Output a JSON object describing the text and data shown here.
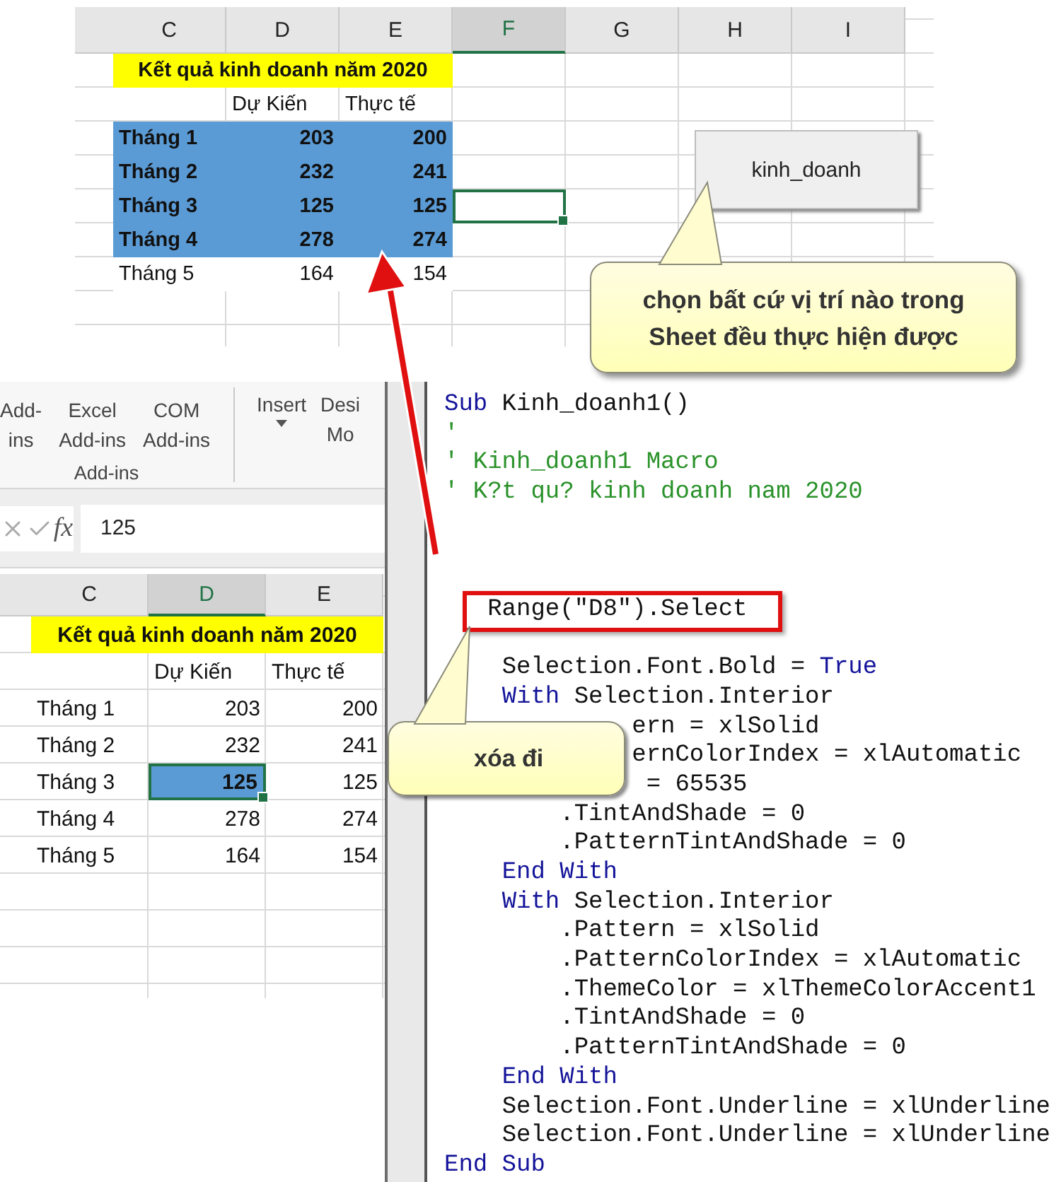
{
  "top_sheet": {
    "columns": [
      {
        "label": "C",
        "selected": false
      },
      {
        "label": "D",
        "selected": false
      },
      {
        "label": "E",
        "selected": false
      },
      {
        "label": "F",
        "selected": true
      },
      {
        "label": "G",
        "selected": false
      },
      {
        "label": "H",
        "selected": false
      },
      {
        "label": "I",
        "selected": false
      }
    ],
    "title": "Kết quả kinh doanh năm 2020",
    "headers": [
      "Dự Kiến",
      "Thực tế"
    ],
    "rows": [
      {
        "month": "Tháng 1",
        "planned": "203",
        "actual": "200",
        "highlighted": true,
        "f_selected": false
      },
      {
        "month": "Tháng 2",
        "planned": "232",
        "actual": "241",
        "highlighted": true,
        "f_selected": false
      },
      {
        "month": "Tháng 3",
        "planned": "125",
        "actual": "125",
        "highlighted": true,
        "f_selected": true
      },
      {
        "month": "Tháng 4",
        "planned": "278",
        "actual": "274",
        "highlighted": true,
        "f_selected": false
      },
      {
        "month": "Tháng 5",
        "planned": "164",
        "actual": "154",
        "highlighted": false,
        "f_selected": false
      }
    ]
  },
  "macro_button": {
    "label": "kinh_doanh"
  },
  "callouts": [
    {
      "kind": "top",
      "text": "chọn bất cứ vị trí nào trong Sheet đều thực hiện được"
    },
    {
      "kind": "code",
      "text": "xóa đi"
    }
  ],
  "ribbon": {
    "buttons": [
      {
        "label": "Add-\nins",
        "dropdown": false
      },
      {
        "label": "Excel\nAdd-ins",
        "dropdown": false
      },
      {
        "label": "COM\nAdd-ins",
        "dropdown": false
      },
      {
        "label": "Insert",
        "dropdown": true
      },
      {
        "label": "Desi\nMo",
        "dropdown": false
      }
    ],
    "group_label": "Add-ins"
  },
  "formula_bar": {
    "function_label": "fx",
    "value": "125"
  },
  "bottom_sheet": {
    "columns": [
      {
        "label": "C",
        "selected": false
      },
      {
        "label": "D",
        "selected": true
      },
      {
        "label": "E",
        "selected": false
      }
    ],
    "title": "Kết quả kinh doanh năm 2020",
    "headers": [
      "Dự Kiến",
      "Thực tế"
    ],
    "rows": [
      {
        "month": "Tháng 1",
        "planned": "203",
        "actual": "200",
        "selected": false
      },
      {
        "month": "Tháng 2",
        "planned": "232",
        "actual": "241",
        "selected": false
      },
      {
        "month": "Tháng 3",
        "planned": "125",
        "actual": "125",
        "selected": true
      },
      {
        "month": "Tháng 4",
        "planned": "278",
        "actual": "274",
        "selected": false
      },
      {
        "month": "Tháng 5",
        "planned": "164",
        "actual": "154",
        "selected": false
      }
    ]
  },
  "code_editor": {
    "lines": [
      {
        "kind": "code",
        "tokens": [
          {
            "kind": "keyword",
            "text": "Sub"
          },
          {
            "kind": "plain",
            "text": " Kinh_doanh1()"
          }
        ]
      },
      {
        "kind": "code",
        "tokens": [
          {
            "kind": "comment",
            "text": "'"
          }
        ]
      },
      {
        "kind": "code",
        "tokens": [
          {
            "kind": "comment",
            "text": "' Kinh_doanh1 Macro"
          }
        ]
      },
      {
        "kind": "code",
        "tokens": [
          {
            "kind": "comment",
            "text": "' K?t qu? kinh doanh nam 2020"
          }
        ]
      },
      {
        "kind": "blank"
      },
      {
        "kind": "blank"
      },
      {
        "kind": "blank"
      },
      {
        "kind": "code",
        "boxed": true,
        "tokens": [
          {
            "kind": "plain",
            "text": "   Range(\"D8\").Select"
          }
        ]
      },
      {
        "kind": "blank"
      },
      {
        "kind": "code",
        "tokens": [
          {
            "kind": "plain",
            "text": "    Selection.Font.Bold = "
          },
          {
            "kind": "keyword",
            "text": "True"
          }
        ]
      },
      {
        "kind": "code",
        "tokens": [
          {
            "kind": "keyword",
            "text": "    With"
          },
          {
            "kind": "plain",
            "text": " Selection.Interior"
          }
        ]
      },
      {
        "kind": "code",
        "tokens": [
          {
            "kind": "plain",
            "text": "             ern = xlSolid"
          }
        ]
      },
      {
        "kind": "code",
        "tokens": [
          {
            "kind": "plain",
            "text": "             ernColorIndex = xlAutomatic"
          }
        ]
      },
      {
        "kind": "code",
        "tokens": [
          {
            "kind": "plain",
            "text": "              = 65535"
          }
        ]
      },
      {
        "kind": "code",
        "tokens": [
          {
            "kind": "plain",
            "text": "        .TintAndShade = 0"
          }
        ]
      },
      {
        "kind": "code",
        "tokens": [
          {
            "kind": "plain",
            "text": "        .PatternTintAndShade = 0"
          }
        ]
      },
      {
        "kind": "code",
        "tokens": [
          {
            "kind": "keyword",
            "text": "    End With"
          }
        ]
      },
      {
        "kind": "code",
        "tokens": [
          {
            "kind": "keyword",
            "text": "    With"
          },
          {
            "kind": "plain",
            "text": " Selection.Interior"
          }
        ]
      },
      {
        "kind": "code",
        "tokens": [
          {
            "kind": "plain",
            "text": "        .Pattern = xlSolid"
          }
        ]
      },
      {
        "kind": "code",
        "tokens": [
          {
            "kind": "plain",
            "text": "        .PatternColorIndex = xlAutomatic"
          }
        ]
      },
      {
        "kind": "code",
        "tokens": [
          {
            "kind": "plain",
            "text": "        .ThemeColor = xlThemeColorAccent1"
          }
        ]
      },
      {
        "kind": "code",
        "tokens": [
          {
            "kind": "plain",
            "text": "        .TintAndShade = 0"
          }
        ]
      },
      {
        "kind": "code",
        "tokens": [
          {
            "kind": "plain",
            "text": "        .PatternTintAndShade = 0"
          }
        ]
      },
      {
        "kind": "code",
        "tokens": [
          {
            "kind": "keyword",
            "text": "    End With"
          }
        ]
      },
      {
        "kind": "code",
        "tokens": [
          {
            "kind": "plain",
            "text": "    Selection.Font.Underline = xlUnderline"
          }
        ]
      },
      {
        "kind": "code",
        "tokens": [
          {
            "kind": "plain",
            "text": "    Selection.Font.Underline = xlUnderline"
          }
        ]
      },
      {
        "kind": "code",
        "tokens": [
          {
            "kind": "keyword",
            "text": "End Sub"
          }
        ]
      }
    ]
  }
}
